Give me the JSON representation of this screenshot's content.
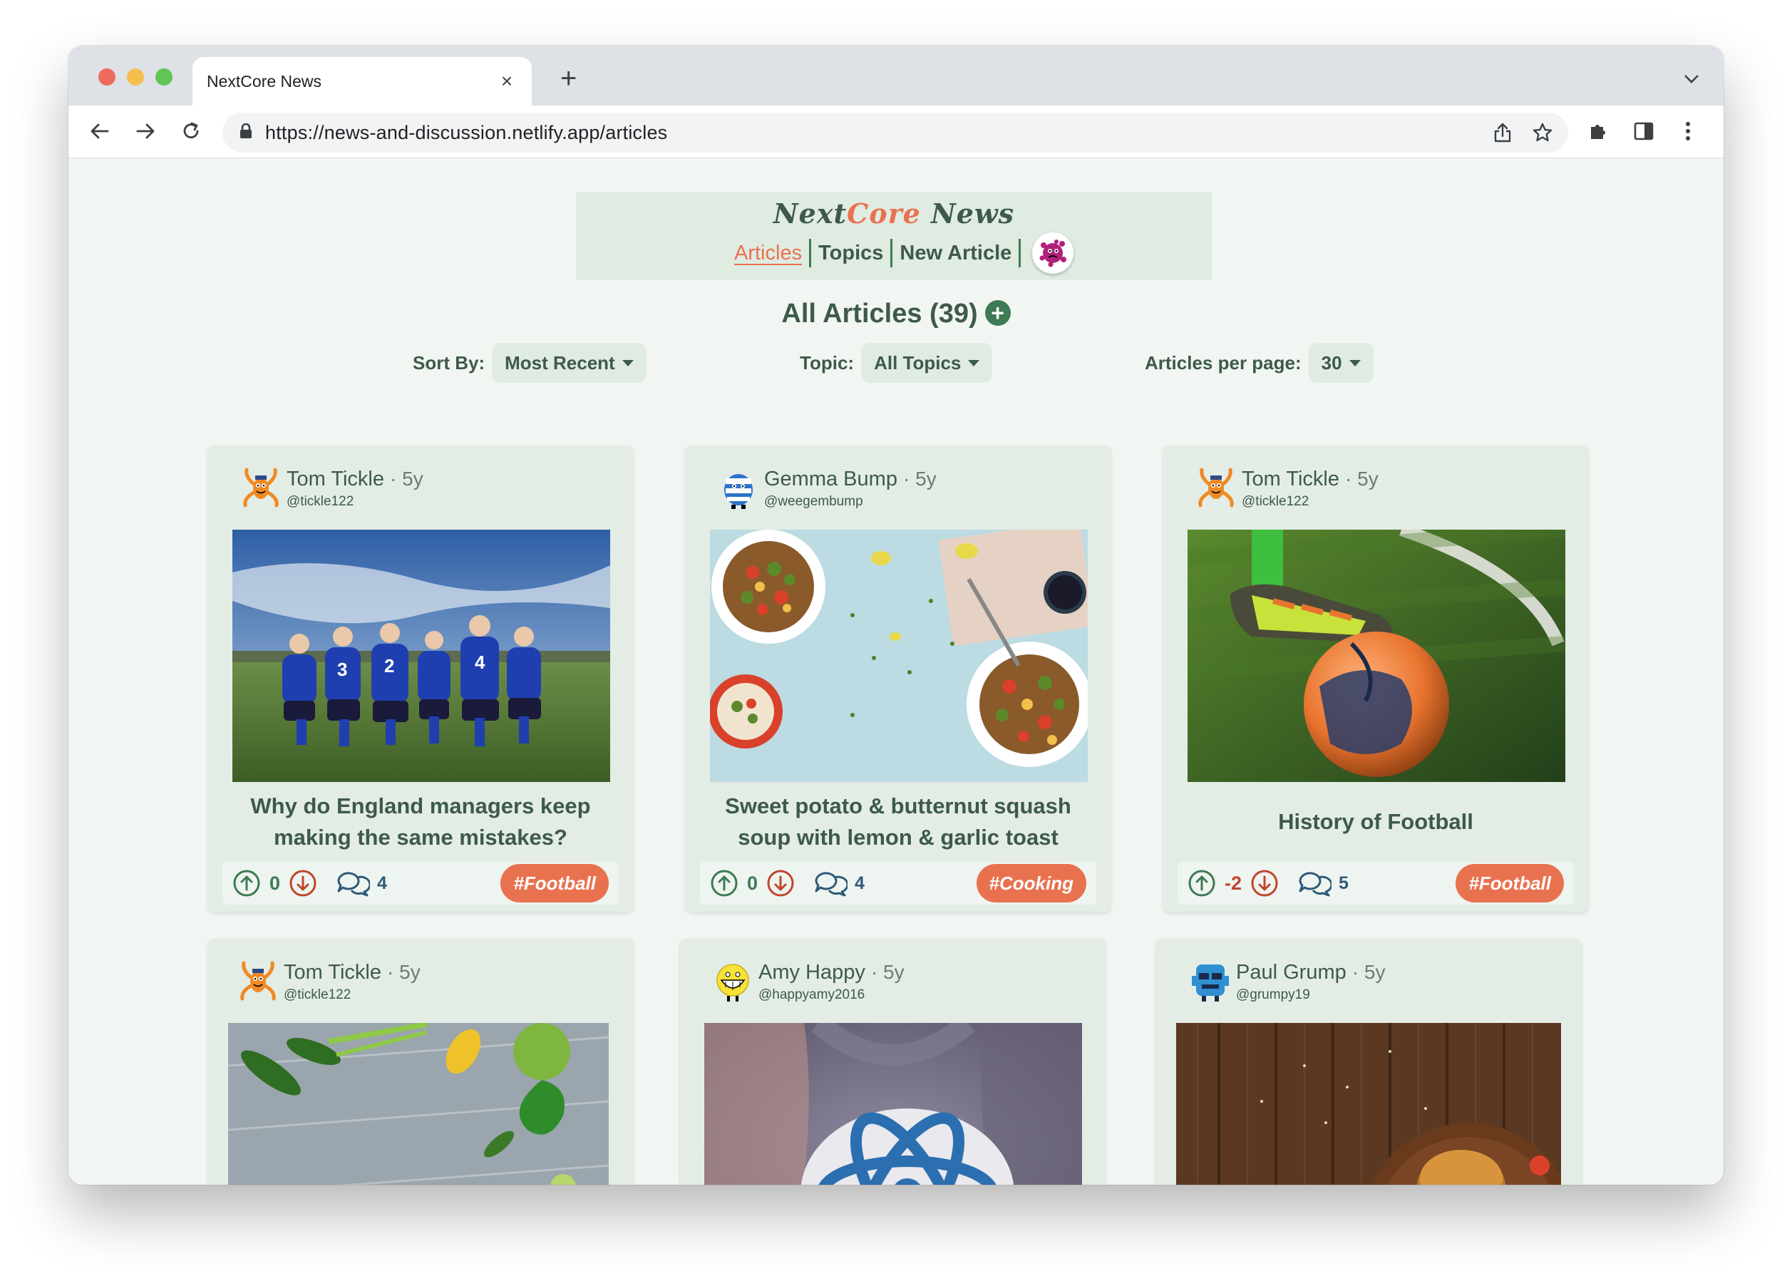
{
  "browser": {
    "tab_title": "NextCore News",
    "tab_close": "×",
    "new_tab": "+",
    "url": "https://news-and-discussion.netlify.app/articles"
  },
  "site": {
    "logo_next": "Next",
    "logo_core": "Core",
    "logo_news": " News",
    "nav": {
      "articles": "Articles",
      "topics": "Topics",
      "new_article": "New Article"
    }
  },
  "page": {
    "title": "All Articles (39)",
    "add_symbol": "+"
  },
  "controls": {
    "sort_label": "Sort By:",
    "sort_value": "Most Recent",
    "topic_label": "Topic:",
    "topic_value": "All Topics",
    "per_page_label": "Articles per page:",
    "per_page_value": "30"
  },
  "colors": {
    "accent": "#e8724f",
    "brand_green": "#3e5a49",
    "card_bg": "#e3ede6",
    "upvote": "#3e7a53",
    "downvote": "#c0452b",
    "comment": "#2f5a78"
  },
  "articles": [
    {
      "author": "Tom Tickle",
      "age": "· 5y",
      "handle": "@tickle122",
      "title": "Why do England managers keep making the same mistakes?",
      "votes": "0",
      "comments": "4",
      "topic": "#Football",
      "avatar_icon": "tickle-avatar-icon",
      "image": "football-team-image"
    },
    {
      "author": "Gemma Bump",
      "age": "· 5y",
      "handle": "@weegembump",
      "title": "Sweet potato & butternut squash soup with lemon & garlic toast",
      "votes": "0",
      "comments": "4",
      "topic": "#Cooking",
      "avatar_icon": "bump-avatar-icon",
      "image": "salad-bowls-image"
    },
    {
      "author": "Tom Tickle",
      "age": "· 5y",
      "handle": "@tickle122",
      "title": "History of Football",
      "votes": "-2",
      "comments": "5",
      "topic": "#Football",
      "avatar_icon": "tickle-avatar-icon",
      "image": "football-boot-ball-image"
    },
    {
      "author": "Tom Tickle",
      "age": "· 5y",
      "handle": "@tickle122",
      "avatar_icon": "tickle-avatar-icon",
      "image": "vegetables-image"
    },
    {
      "author": "Amy Happy",
      "age": "· 5y",
      "handle": "@happyamy2016",
      "avatar_icon": "happy-avatar-icon",
      "image": "react-logo-image"
    },
    {
      "author": "Paul Grump",
      "age": "· 5y",
      "handle": "@grumpy19",
      "avatar_icon": "grump-avatar-icon",
      "image": "burger-wood-image"
    }
  ]
}
